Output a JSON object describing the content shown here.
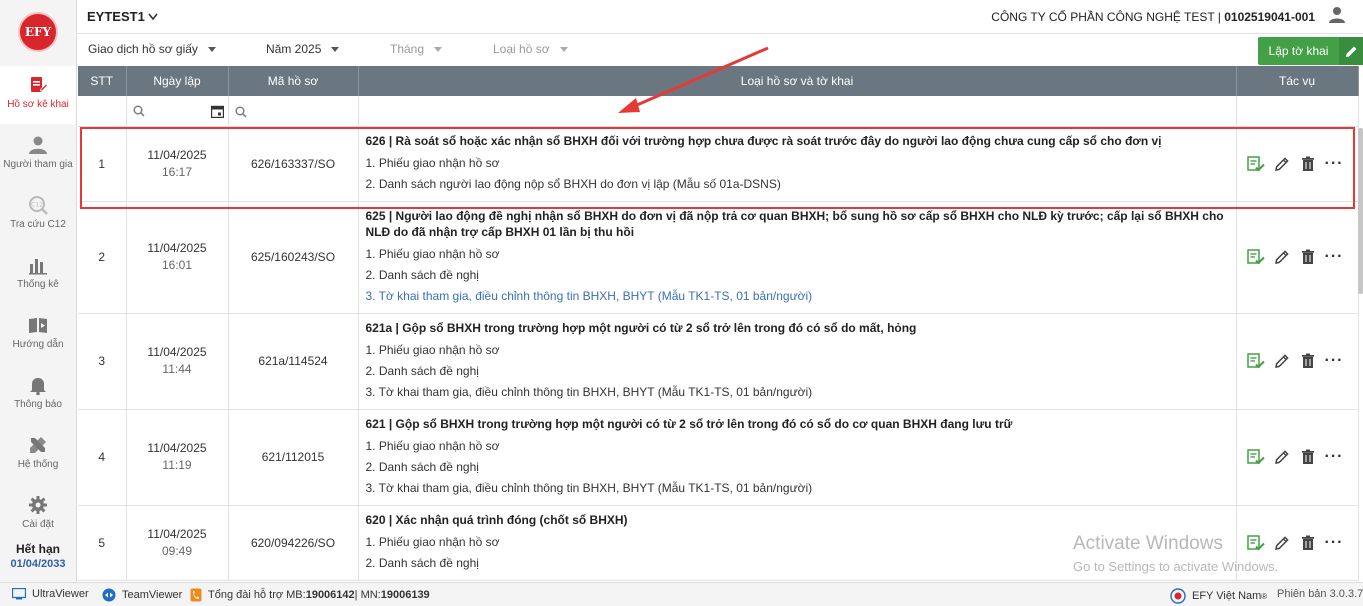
{
  "logo": "EFY",
  "sidebar": {
    "items": [
      {
        "label": "Hồ sơ kê khai",
        "icon": "document-edit-icon"
      },
      {
        "label": "Người tham gia",
        "icon": "person-icon"
      },
      {
        "label": "Tra cứu C12",
        "icon": "search-c12-icon"
      },
      {
        "label": "Thống kê",
        "icon": "bar-chart-icon"
      },
      {
        "label": "Hướng dẫn",
        "icon": "guide-book-icon"
      },
      {
        "label": "Thông báo",
        "icon": "bell-icon"
      },
      {
        "label": "Hệ thống",
        "icon": "tools-icon"
      },
      {
        "label": "Cài đặt",
        "icon": "gear-icon"
      }
    ],
    "expire_label": "Hết hạn",
    "expire_date": "01/04/2033"
  },
  "header": {
    "tenant": "EYTEST1",
    "company": "CÔNG TY CỔ PHẦN CÔNG NGHỆ TEST | ",
    "tax_code": "0102519041-001"
  },
  "filters": {
    "type": "Giao dịch hồ sơ giấy",
    "year": "Năm 2025",
    "month": "Tháng",
    "form": "Loại hồ sơ"
  },
  "create_button": "Lập tờ khai",
  "table": {
    "columns": [
      "STT",
      "Ngày lập",
      "Mã hồ sơ",
      "Loại hồ sơ và tờ khai",
      "Tác vụ"
    ],
    "rows": [
      {
        "stt": "1",
        "date": "11/04/2025",
        "time": "16:17",
        "code": "626/163337/SO",
        "title": "626 | Rà soát sổ hoặc xác nhận sổ BHXH đối với trường hợp chưa được rà soát trước đây do người lao động chưa cung cấp sổ cho đơn vị",
        "items": [
          "1. Phiếu giao nhận hồ sơ",
          "2. Danh sách người lao động nộp sổ BHXH do đơn vị lập (Mẫu số 01a-DSNS)"
        ]
      },
      {
        "stt": "2",
        "date": "11/04/2025",
        "time": "16:01",
        "code": "625/160243/SO",
        "title": "625 | Người lao động đề nghị nhận sổ BHXH do đơn vị đã nộp trả cơ quan BHXH; bổ sung hồ sơ cấp sổ BHXH cho NLĐ kỳ trước; cấp lại sổ BHXH cho NLĐ do đã nhận trợ cấp BHXH 01 lần bị thu hồi",
        "items": [
          "1. Phiếu giao nhận hồ sơ",
          "2. Danh sách đề nghị",
          "3. Tờ khai tham gia, điều chỉnh thông tin BHXH, BHYT (Mẫu TK1-TS, 01 bản/người)"
        ]
      },
      {
        "stt": "3",
        "date": "11/04/2025",
        "time": "11:44",
        "code": "621a/114524",
        "title": "621a | Gộp sổ BHXH trong trường hợp một người có từ 2 sổ trở lên trong đó có sổ do mất, hỏng",
        "items": [
          "1. Phiếu giao nhận hồ sơ",
          "2. Danh sách đề nghị",
          "3. Tờ khai tham gia, điều chỉnh thông tin BHXH, BHYT (Mẫu TK1-TS, 01 bản/người)"
        ]
      },
      {
        "stt": "4",
        "date": "11/04/2025",
        "time": "11:19",
        "code": "621/112015",
        "title": "621 | Gộp sổ BHXH trong trường hợp một người có từ 2 sổ trở lên trong đó có sổ do cơ quan BHXH đang lưu trữ",
        "items": [
          "1. Phiếu giao nhận hồ sơ",
          "2. Danh sách đề nghị",
          "3. Tờ khai tham gia, điều chỉnh thông tin BHXH, BHYT (Mẫu TK1-TS, 01 bản/người)"
        ]
      },
      {
        "stt": "5",
        "date": "11/04/2025",
        "time": "09:49",
        "code": "620/094226/SO",
        "title": "620 | Xác nhận quá trình đóng (chốt sổ BHXH)",
        "items": [
          "1. Phiếu giao nhận hồ sơ",
          "2. Danh sách đề nghị"
        ]
      }
    ]
  },
  "watermark": {
    "line1": "Activate Windows",
    "line2": "Go to Settings to activate Windows."
  },
  "footer": {
    "ultraviewer": "UltraViewer",
    "teamviewer": "TeamViewer",
    "hotline_prefix": "Tổng đài hỗ trợ MB: ",
    "mb": "19006142",
    "sep": " | MN: ",
    "mn": "19006139",
    "brand": "EFY Việt Nam",
    "version": "Phiên bản 3.0.3.7"
  },
  "colors": {
    "accent": "#d7262c",
    "header": "#6b7780",
    "green": "#43a047",
    "link": "#3a6fb7"
  }
}
